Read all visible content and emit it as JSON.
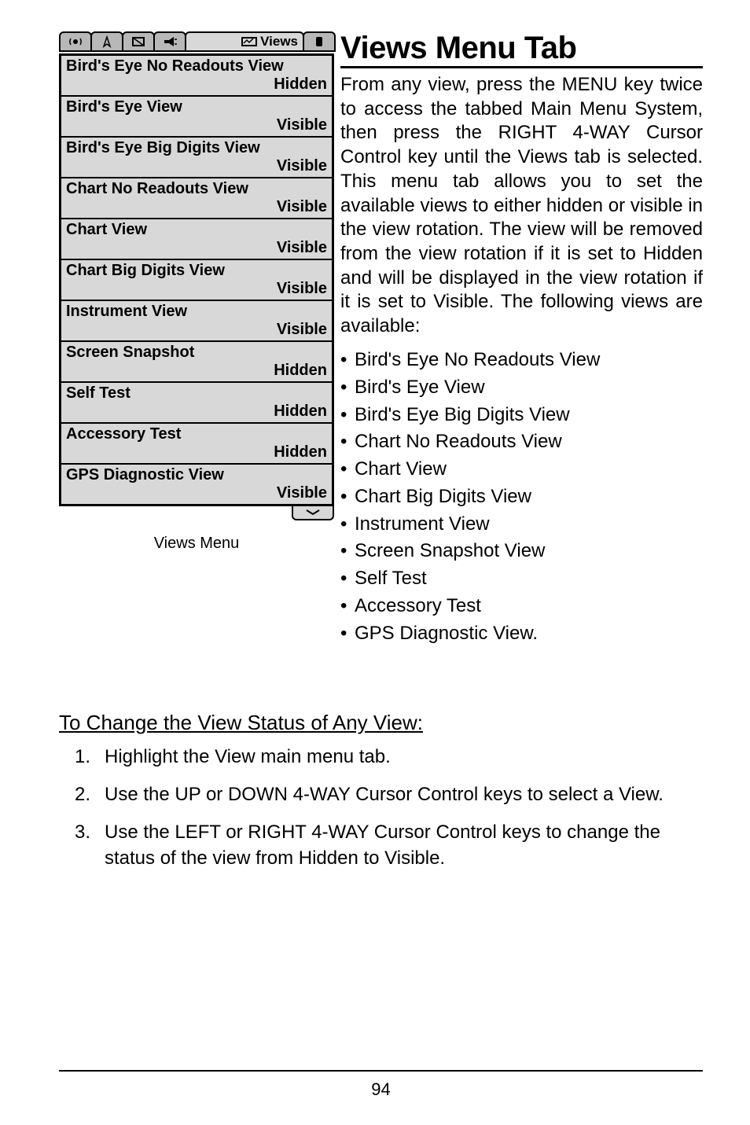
{
  "tabs": {
    "active_label": "Views"
  },
  "menu_caption": "Views Menu",
  "menu": [
    {
      "label": "Bird's Eye No Readouts View",
      "value": "Hidden"
    },
    {
      "label": "Bird's Eye View",
      "value": "Visible"
    },
    {
      "label": "Bird's Eye Big Digits View",
      "value": "Visible"
    },
    {
      "label": "Chart No Readouts View",
      "value": "Visible"
    },
    {
      "label": "Chart View",
      "value": "Visible"
    },
    {
      "label": "Chart Big Digits View",
      "value": "Visible"
    },
    {
      "label": "Instrument View",
      "value": "Visible"
    },
    {
      "label": "Screen Snapshot",
      "value": "Hidden"
    },
    {
      "label": "Self Test",
      "value": "Hidden"
    },
    {
      "label": "Accessory Test",
      "value": "Hidden"
    },
    {
      "label": "GPS Diagnostic View",
      "value": "Visible"
    }
  ],
  "title": "Views Menu Tab",
  "intro": "From any view, press the MENU key twice to access the tabbed Main Menu System, then press the RIGHT 4-WAY Cursor Control key until the Views tab is selected. This menu tab allows you to set the available views to either hidden or visible in the view rotation. The view will be removed from the view rotation if it is set to Hidden and will be displayed in the view rotation if it is set to Visible. The following views are available:",
  "bullets": [
    "Bird's Eye No Readouts View",
    "Bird's Eye View",
    "Bird's Eye Big Digits View",
    "Chart No Readouts View",
    "Chart View",
    "Chart Big Digits View",
    "Instrument View",
    "Screen Snapshot View",
    "Self Test",
    "Accessory Test",
    "GPS Diagnostic View."
  ],
  "section_heading": "To Change the View Status of Any View:",
  "steps": [
    "Highlight the View main menu tab.",
    "Use the UP or DOWN 4-WAY Cursor Control keys to select a View.",
    "Use the LEFT or RIGHT 4-WAY Cursor Control keys to change the status of the view from Hidden to Visible."
  ],
  "page_number": "94"
}
